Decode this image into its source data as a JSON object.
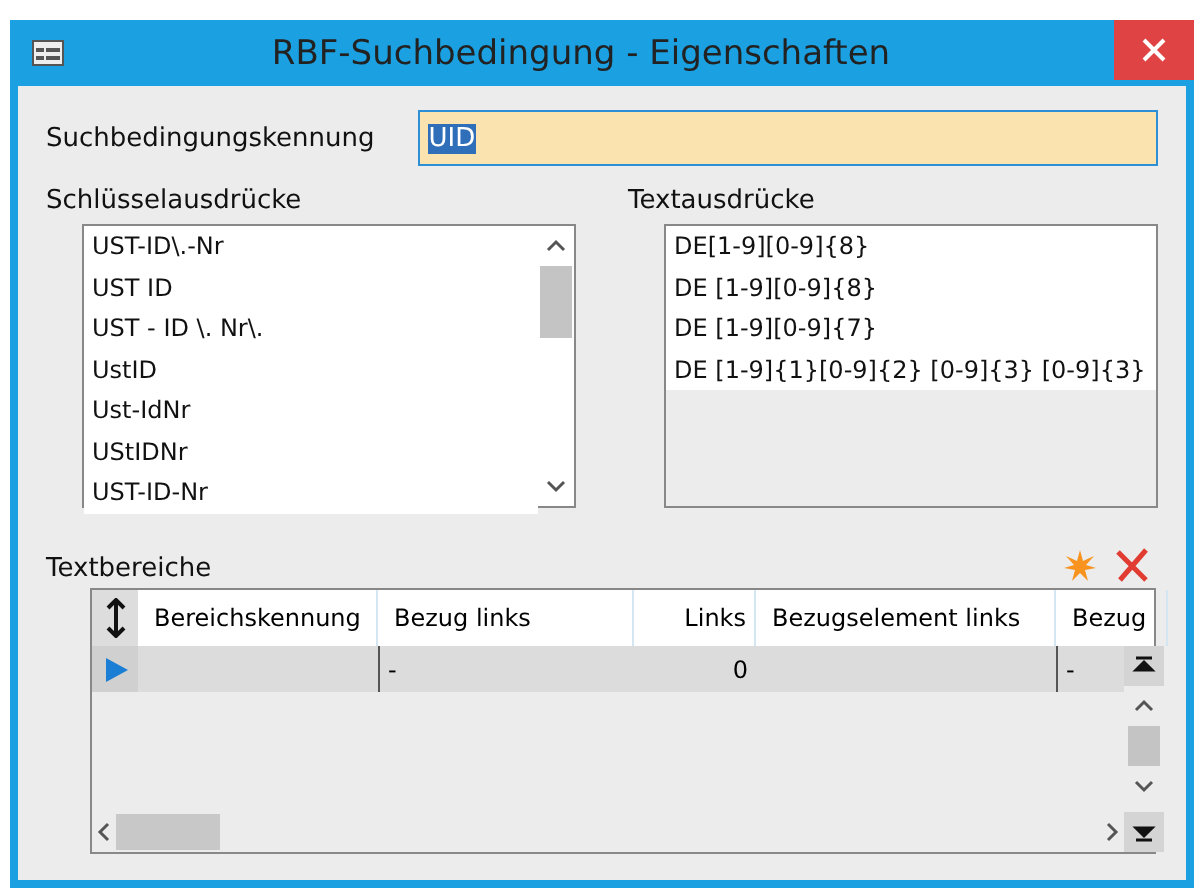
{
  "window": {
    "title": "RBF-Suchbedingung - Eigenschaften"
  },
  "search_condition": {
    "label": "Suchbedingungskennung",
    "value": "UID",
    "text_selected": true
  },
  "key_expressions": {
    "label": "Schlüsselausdrücke",
    "items": [
      "UST-ID\\.-Nr",
      "UST ID",
      "UST - ID \\. Nr\\.",
      "UstID",
      "Ust-IdNr",
      "UStIDNr",
      "UST-ID-Nr"
    ]
  },
  "text_expressions": {
    "label": "Textausdrücke",
    "items": [
      "DE[1-9][0-9]{8}",
      "DE [1-9][0-9]{8}",
      "DE [1-9][0-9]{7}",
      "DE [1-9]{1}[0-9]{2} [0-9]{3} [0-9]{3}"
    ]
  },
  "text_areas": {
    "label": "Textbereiche",
    "table": {
      "columns": [
        {
          "label": "Bereichskennung"
        },
        {
          "label": "Bezug links"
        },
        {
          "label": "Links"
        },
        {
          "label": "Bezugselement links"
        },
        {
          "label": "Bezug"
        }
      ],
      "rows": [
        {
          "selected": true,
          "cells": [
            "",
            "-",
            "0",
            "",
            "-"
          ]
        }
      ]
    }
  }
}
